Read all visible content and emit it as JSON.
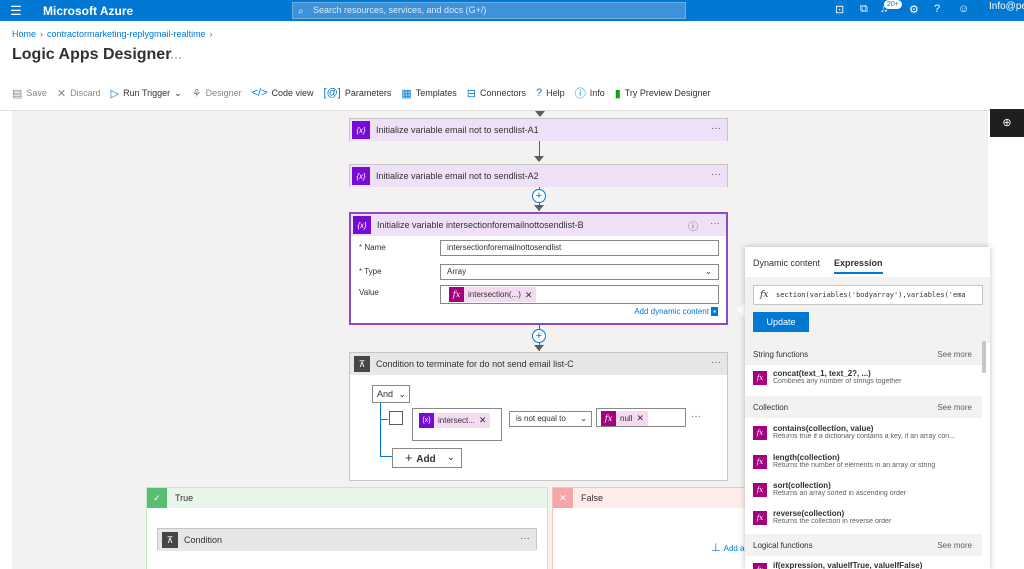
{
  "topbar": {
    "menu_icon": "hamburger-icon",
    "brand": "Microsoft Azure",
    "search_placeholder": "Search resources, services, and docs (G+/)",
    "notif_count": "20+",
    "account": "Info@pe"
  },
  "breadcrumb": {
    "home": "Home",
    "item": "contractormarketing-replygmail-realtime"
  },
  "page": {
    "title": "Logic Apps Designer",
    "more": "···"
  },
  "toolbar": {
    "save": "Save",
    "discard": "Discard",
    "run_trigger": "Run Trigger",
    "designer": "Designer",
    "code_view": "Code view",
    "parameters": "Parameters",
    "templates": "Templates",
    "connectors": "Connectors",
    "help": "Help",
    "info": "Info",
    "preview": "Try Preview Designer"
  },
  "actions": {
    "a1": "Initialize variable email not to sendlist-A1",
    "a2": "Initialize variable email not to sendlist-A2",
    "b": {
      "title": "Initialize variable intersectionforemailnottosendlist-B",
      "name_label": "Name",
      "name_value": "intersectionforemailnottosendlist",
      "type_label": "Type",
      "type_value": "Array",
      "value_label": "Value",
      "value_token": "intersection(...)",
      "add_dynamic": "Add dynamic content"
    },
    "c": {
      "title": "Condition to terminate for do not send email list-C",
      "and": "And",
      "left_token": "intersect...",
      "operator": "is not equal to",
      "right_token": "null",
      "add": "Add"
    },
    "true_branch": "True",
    "false_branch": "False",
    "inner_condition": "Condition",
    "add_action": "Add a"
  },
  "panel": {
    "tab_dynamic": "Dynamic content",
    "tab_expression": "Expression",
    "expression": "section(variables('bodyarray'),variables('ema",
    "update": "Update",
    "sections": [
      {
        "title": "String functions",
        "more": "See more"
      },
      {
        "title": "Collection",
        "more": "See more"
      },
      {
        "title": "Logical functions",
        "more": "See more"
      }
    ],
    "functions": [
      {
        "name": "concat(text_1, text_2?, ...)",
        "desc": "Combines any number of strings together"
      },
      {
        "name": "contains(collection, value)",
        "desc": "Returns true if a dictionary contains a key, if an array con..."
      },
      {
        "name": "length(collection)",
        "desc": "Returns the number of elements in an array or string"
      },
      {
        "name": "sort(collection)",
        "desc": "Returns an array sorted in ascending order"
      },
      {
        "name": "reverse(collection)",
        "desc": "Returns the collection in reverse order"
      },
      {
        "name": "if(expression, valueIfTrue, valueIfFalse)",
        "desc": ""
      }
    ]
  },
  "colors": {
    "accent": "#0078d4",
    "variable": "#770bd6",
    "function": "#a4007f"
  }
}
